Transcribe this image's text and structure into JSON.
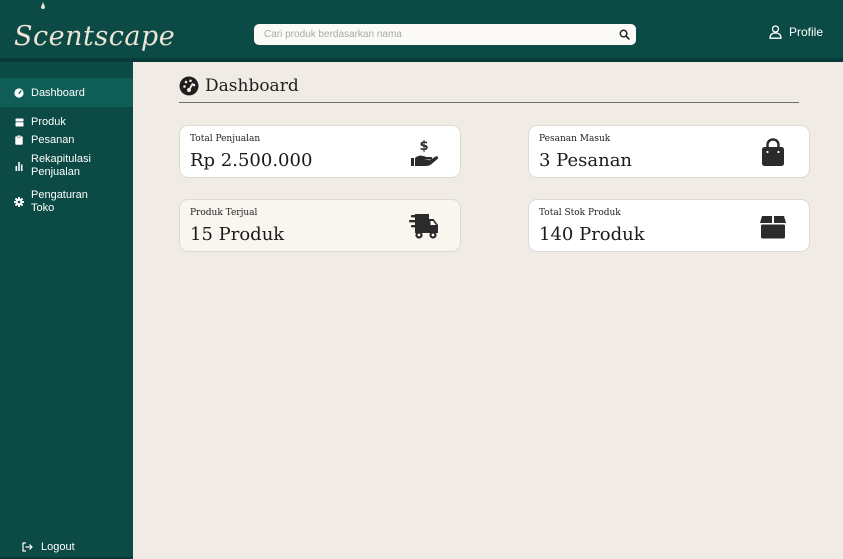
{
  "brand": {
    "name": "Scentscape"
  },
  "search": {
    "placeholder": "Cari produk berdasarkan nama"
  },
  "header": {
    "profile_label": "Profile"
  },
  "sidebar": {
    "items": [
      {
        "label": "Dashboard",
        "icon": "gauge-icon",
        "active": true
      },
      {
        "label": "Produk",
        "icon": "box-icon"
      },
      {
        "label": "Pesanan",
        "icon": "clipboard-icon"
      },
      {
        "label": "Rekapitulasi Penjualan",
        "icon": "bar-chart-icon"
      },
      {
        "label": "Pengaturan Toko",
        "icon": "gear-icon"
      }
    ],
    "logout_label": "Logout"
  },
  "page": {
    "title": "Dashboard"
  },
  "cards": [
    {
      "label": "Total Penjualan",
      "value": "Rp 2.500.000",
      "icon": "hand-dollar-icon"
    },
    {
      "label": "Pesanan Masuk",
      "value": "3 Pesanan",
      "icon": "shopping-bag-icon"
    },
    {
      "label": "Produk Terjual",
      "value": "15 Produk",
      "icon": "delivery-truck-icon"
    },
    {
      "label": "Total Stok Produk",
      "value": "140 Produk",
      "icon": "box-icon"
    }
  ],
  "colors": {
    "primary": "#0b4a45",
    "active": "#0e5e57",
    "background": "#f0ebe4",
    "icon": "#2b2b2b"
  }
}
